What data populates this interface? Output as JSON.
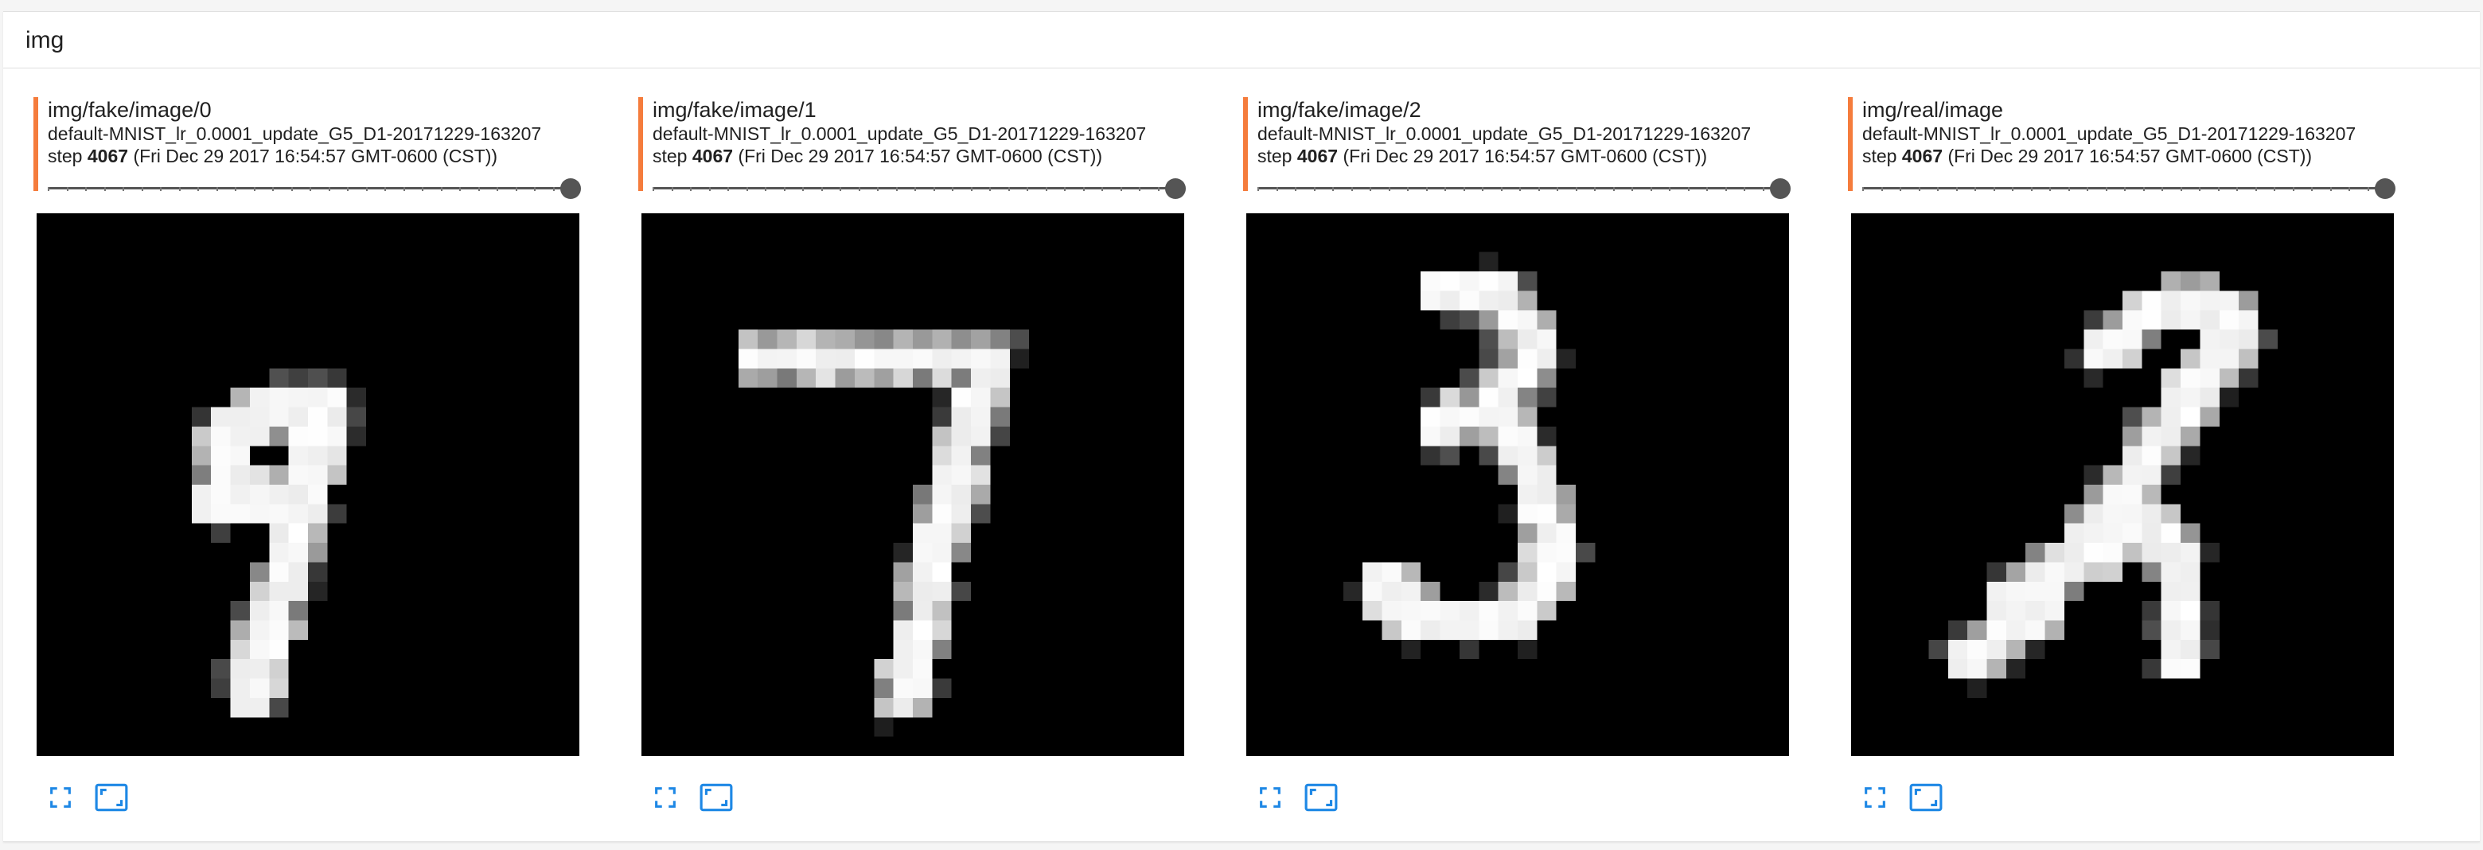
{
  "category": {
    "title": "img"
  },
  "accent_color": "#f57c3c",
  "icon_color": "#1e88e5",
  "cards": [
    {
      "tag": "img/fake/image/0",
      "run": "default-MNIST_lr_0.0001_update_G5_D1-20171229-163207",
      "step_label": "step",
      "step_value": "4067",
      "timestamp": "(Fri Dec 29 2017 16:54:57 GMT-0600 (CST))",
      "image": "MNIST-style digit 9",
      "actions": [
        "expand-icon",
        "fit-image-icon"
      ]
    },
    {
      "tag": "img/fake/image/1",
      "run": "default-MNIST_lr_0.0001_update_G5_D1-20171229-163207",
      "step_label": "step",
      "step_value": "4067",
      "timestamp": "(Fri Dec 29 2017 16:54:57 GMT-0600 (CST))",
      "image": "MNIST-style digit 7",
      "actions": [
        "expand-icon",
        "fit-image-icon"
      ]
    },
    {
      "tag": "img/fake/image/2",
      "run": "default-MNIST_lr_0.0001_update_G5_D1-20171229-163207",
      "step_label": "step",
      "step_value": "4067",
      "timestamp": "(Fri Dec 29 2017 16:54:57 GMT-0600 (CST))",
      "image": "MNIST-style digit 3",
      "actions": [
        "expand-icon",
        "fit-image-icon"
      ]
    },
    {
      "tag": "img/real/image",
      "run": "default-MNIST_lr_0.0001_update_G5_D1-20171229-163207",
      "step_label": "step",
      "step_value": "4067",
      "timestamp": "(Fri Dec 29 2017 16:54:57 GMT-0600 (CST))",
      "image": "MNIST-style digit 2",
      "actions": [
        "expand-icon",
        "fit-image-icon"
      ]
    }
  ]
}
